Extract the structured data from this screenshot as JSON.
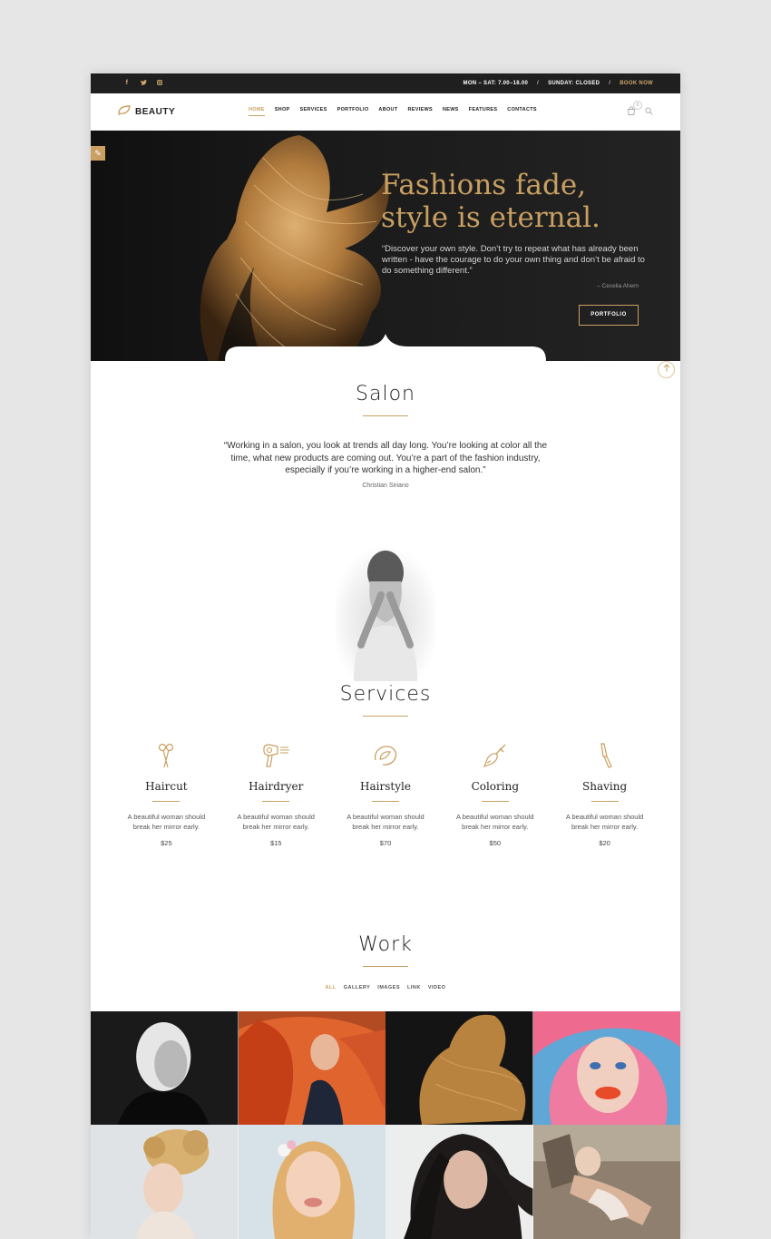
{
  "topbar": {
    "hours_week": "MON – SAT: 7.00–18.00",
    "hours_sunday": "SUNDAY: CLOSED",
    "book_label": "BOOK NOW",
    "separator": "/"
  },
  "header": {
    "logo_text": "BEAUTY",
    "nav": [
      "HOME",
      "SHOP",
      "SERVICES",
      "PORTFOLIO",
      "ABOUT",
      "REVIEWS",
      "NEWS",
      "FEATURES",
      "CONTACTS"
    ],
    "cart_count": "0"
  },
  "hero": {
    "title_line1": "Fashions fade,",
    "title_line2": "style is eternal.",
    "quote": "“Discover your own style. Don’t try to repeat what has already been written - have the courage to do your own thing and don’t be afraid to do something different.”",
    "author": "– Cecelia Ahern",
    "button": "PORTFOLIO"
  },
  "salon": {
    "title": "Salon",
    "quote": "“Working in a salon, you look at trends all day long. You’re looking at color all the time, what new products are coming out. You’re a part of the fashion industry, especially if you’re working in a higher-end salon.”",
    "author": "Christian Siriano"
  },
  "services": {
    "title": "Services",
    "items": [
      {
        "name": "Haircut",
        "desc": "A beautiful woman should break her mirror early.",
        "price": "$25",
        "icon": "scissors-icon"
      },
      {
        "name": "Hairdryer",
        "desc": "A beautiful woman should break her mirror early.",
        "price": "$15",
        "icon": "hairdryer-icon"
      },
      {
        "name": "Hairstyle",
        "desc": "A beautiful woman should break her mirror early.",
        "price": "$70",
        "icon": "hairstyle-icon"
      },
      {
        "name": "Coloring",
        "desc": "A beautiful woman should break her mirror early.",
        "price": "$50",
        "icon": "brush-icon"
      },
      {
        "name": "Shaving",
        "desc": "A beautiful woman should break her mirror early.",
        "price": "$20",
        "icon": "razor-icon"
      }
    ]
  },
  "work": {
    "title": "Work",
    "filters": [
      "ALL",
      "GALLERY",
      "IMAGES",
      "LINK",
      "VIDEO"
    ],
    "active_filter": "ALL"
  },
  "colors": {
    "accent": "#c9a062",
    "dark": "#1f1f1f"
  }
}
